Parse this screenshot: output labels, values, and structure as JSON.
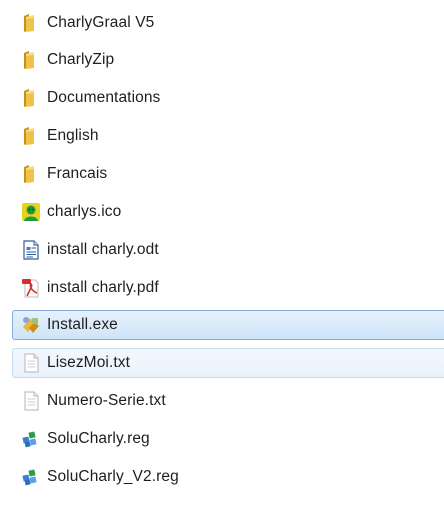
{
  "files": [
    {
      "name": "CharlyGraal V5",
      "icon": "folder-icon",
      "state": "normal"
    },
    {
      "name": "CharlyZip",
      "icon": "folder-icon",
      "state": "normal"
    },
    {
      "name": "Documentations",
      "icon": "folder-icon",
      "state": "normal"
    },
    {
      "name": "English",
      "icon": "folder-icon",
      "state": "normal"
    },
    {
      "name": "Francais",
      "icon": "folder-icon",
      "state": "normal"
    },
    {
      "name": "charlys.ico",
      "icon": "ico-image-icon",
      "state": "normal"
    },
    {
      "name": "install charly.odt",
      "icon": "odt-document-icon",
      "state": "normal"
    },
    {
      "name": "install charly.pdf",
      "icon": "pdf-document-icon",
      "state": "normal"
    },
    {
      "name": "Install.exe",
      "icon": "installer-exe-icon",
      "state": "selected"
    },
    {
      "name": "LisezMoi.txt",
      "icon": "text-file-icon",
      "state": "hover"
    },
    {
      "name": "Numero-Serie.txt",
      "icon": "text-file-icon",
      "state": "normal"
    },
    {
      "name": "SoluCharly.reg",
      "icon": "registry-file-icon",
      "state": "normal"
    },
    {
      "name": "SoluCharly_V2.reg",
      "icon": "registry-file-icon",
      "state": "normal"
    }
  ],
  "colors": {
    "selection_fill": "#cfe4f9",
    "selection_border": "#84acdd",
    "hover_fill": "#e9f2fb",
    "folder": "#e8b93c"
  }
}
